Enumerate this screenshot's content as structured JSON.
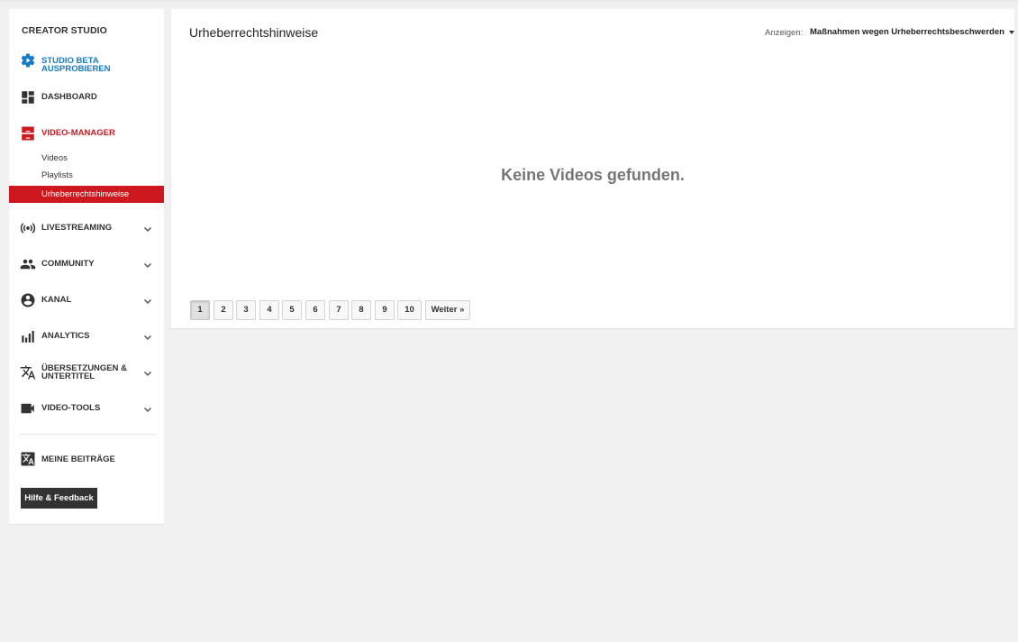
{
  "sidebar": {
    "brand": "CREATOR STUDIO",
    "studio_beta": {
      "line1": "STUDIO BETA",
      "line2": "AUSPROBIEREN",
      "icon": "gear-play-icon"
    },
    "dashboard": {
      "label": "DASHBOARD",
      "icon": "dashboard-icon"
    },
    "video_manager": {
      "label": "VIDEO-MANAGER",
      "icon": "video-manager-icon"
    },
    "sub_items": [
      {
        "label": "Videos"
      },
      {
        "label": "Playlists"
      },
      {
        "label": "Urheberrechtshinweise",
        "active": true
      }
    ],
    "livestreaming": {
      "label": "LIVESTREAMING",
      "icon": "broadcast-icon"
    },
    "community": {
      "label": "COMMUNITY",
      "icon": "people-icon"
    },
    "kanal": {
      "label": "KANAL",
      "icon": "account-icon"
    },
    "analytics": {
      "label": "ANALYTICS",
      "icon": "bar-chart-icon"
    },
    "translations": {
      "line1": "ÜBERSETZUNGEN &",
      "line2": "UNTERTITEL",
      "icon": "translate-icon"
    },
    "video_tools": {
      "label": "VIDEO-TOOLS",
      "icon": "video-camera-icon"
    },
    "meine_beitraege": {
      "label": "MEINE BEITRÄGE",
      "icon": "translate-box-icon"
    },
    "help_button": "Hilfe & Feedback"
  },
  "main": {
    "title": "Urheberrechtshinweise",
    "filter_label": "Anzeigen:",
    "filter_value": "Maßnahmen wegen Urheberrechtsbeschwerden",
    "empty_message": "Keine Videos gefunden.",
    "pagination": {
      "pages": [
        "1",
        "2",
        "3",
        "4",
        "5",
        "6",
        "7",
        "8",
        "9",
        "10"
      ],
      "current": "1",
      "next": "Weiter »"
    }
  },
  "colors": {
    "accent_red": "#cc181e",
    "accent_blue": "#167ac6",
    "text_dark": "#333333",
    "background": "#f1f1f1"
  }
}
